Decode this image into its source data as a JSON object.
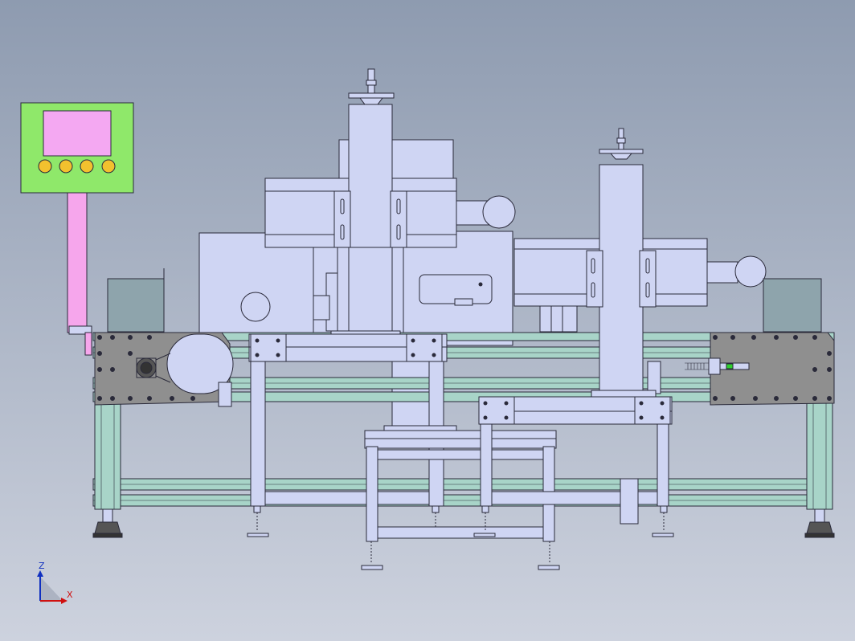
{
  "viewport": {
    "background_top": "#8e9bb0",
    "background_bottom": "#cdd2de"
  },
  "colors": {
    "line": "#2a2a3a",
    "machine_fill": "#cfd5f3",
    "machine_fill_dark": "#b9c0e6",
    "frame_green": "#a8d4c8",
    "plate_gray": "#8f8f8f",
    "hmi_green": "#8fe86a",
    "hmi_screen": "#f4a8f2",
    "hmi_button": "#f2c12e",
    "hmi_pole": "#f6a6ec",
    "bin_fill": "#8ea4ac",
    "axis_z": "#1030c0",
    "axis_x": "#d01010",
    "sensor_green": "#2fd02f"
  },
  "axis_triad": {
    "z_label": "Z",
    "x_label": "X"
  }
}
